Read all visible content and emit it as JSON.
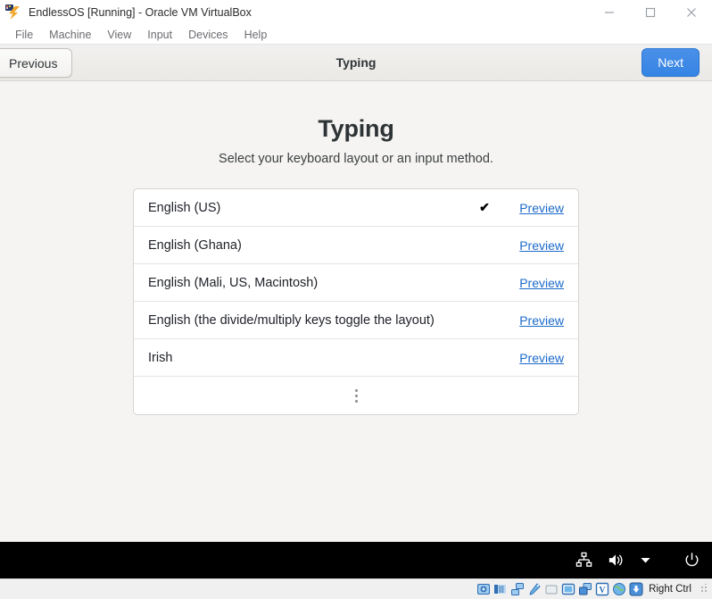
{
  "window": {
    "title": "EndlessOS [Running] - Oracle VM VirtualBox",
    "app_icon": "virtualbox-icon",
    "controls": {
      "minimize": "minimize-icon",
      "maximize": "maximize-icon",
      "close": "close-icon"
    }
  },
  "menubar": {
    "items": [
      {
        "label": "File"
      },
      {
        "label": "Machine"
      },
      {
        "label": "View"
      },
      {
        "label": "Input"
      },
      {
        "label": "Devices"
      },
      {
        "label": "Help"
      }
    ]
  },
  "headerbar": {
    "previous_label": "Previous",
    "title": "Typing",
    "next_label": "Next",
    "next_color": "#3584e4"
  },
  "page": {
    "title": "Typing",
    "subtitle": "Select your keyboard layout or an input method."
  },
  "keyboard_list": {
    "check_glyph": "✔",
    "preview_label": "Preview",
    "more_icon": "three-dots-vertical-icon",
    "link_color": "#1b6acb",
    "rows": [
      {
        "label": "English (US)",
        "selected": true
      },
      {
        "label": "English (Ghana)",
        "selected": false
      },
      {
        "label": "English (Mali, US, Macintosh)",
        "selected": false
      },
      {
        "label": "English (the divide/multiply keys toggle the layout)",
        "selected": false
      },
      {
        "label": "Irish",
        "selected": false
      }
    ]
  },
  "gnome_tray": {
    "icons": [
      {
        "name": "network-wired-icon"
      },
      {
        "name": "volume-icon"
      },
      {
        "name": "chevron-down-icon"
      },
      {
        "name": "power-icon"
      }
    ]
  },
  "statusbar": {
    "icons": [
      {
        "name": "hard-disk-icon"
      },
      {
        "name": "optical-drive-icon"
      },
      {
        "name": "network-adapter-icon"
      },
      {
        "name": "usb-icon"
      },
      {
        "name": "shared-folders-icon"
      },
      {
        "name": "display-icon"
      },
      {
        "name": "remote-desktop-icon"
      },
      {
        "name": "video-capture-icon"
      },
      {
        "name": "globe-icon"
      },
      {
        "name": "mouse-integration-icon"
      }
    ],
    "host_key": "Right Ctrl",
    "resize_grip": "resize-grip-icon"
  }
}
